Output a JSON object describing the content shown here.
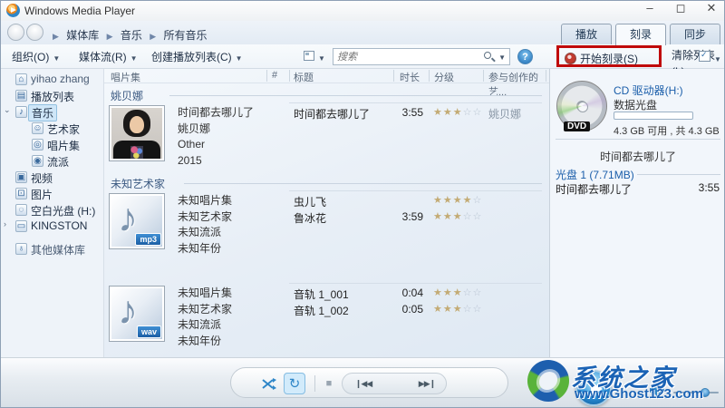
{
  "window": {
    "title": "Windows Media Player",
    "minimize": "–",
    "maximize": "◻",
    "close": "✕"
  },
  "breadcrumb": {
    "items": [
      "媒体库",
      "音乐",
      "所有音乐"
    ]
  },
  "tabs": [
    {
      "label": "播放",
      "active": false
    },
    {
      "label": "刻录",
      "active": true
    },
    {
      "label": "同步",
      "active": false
    }
  ],
  "toolbar": {
    "organize": "组织(O)",
    "stream": "媒体流(R)",
    "create_playlist": "创建播放列表(C)",
    "search_placeholder": "搜索",
    "help": "?"
  },
  "burn_toolbar": {
    "start_burn": "开始刻录(S)",
    "clear_list": "清除列表(L)"
  },
  "sidebar": {
    "items": [
      {
        "label": "yihao zhang",
        "level": 0,
        "icon": "library-icon",
        "chevron": "",
        "selected": false,
        "dim": true,
        "gap": false
      },
      {
        "label": "播放列表",
        "level": 0,
        "icon": "playlist-icon",
        "chevron": "",
        "selected": false,
        "dim": false,
        "gap": false
      },
      {
        "label": "音乐",
        "level": 0,
        "icon": "music-icon",
        "chevron": "v",
        "selected": true,
        "dim": false,
        "gap": false
      },
      {
        "label": "艺术家",
        "level": 1,
        "icon": "artist-icon",
        "chevron": "",
        "selected": false,
        "dim": false,
        "gap": false
      },
      {
        "label": "唱片集",
        "level": 1,
        "icon": "album-icon",
        "chevron": "",
        "selected": false,
        "dim": false,
        "gap": false
      },
      {
        "label": "流派",
        "level": 1,
        "icon": "genre-icon",
        "chevron": "",
        "selected": false,
        "dim": false,
        "gap": false
      },
      {
        "label": "视频",
        "level": 0,
        "icon": "video-icon",
        "chevron": "",
        "selected": false,
        "dim": false,
        "gap": false
      },
      {
        "label": "图片",
        "level": 0,
        "icon": "pictures-icon",
        "chevron": "",
        "selected": false,
        "dim": false,
        "gap": false
      },
      {
        "label": "空白光盘 (H:)",
        "level": 0,
        "icon": "blank-disc-icon",
        "chevron": "",
        "selected": false,
        "dim": false,
        "gap": false
      },
      {
        "label": "KINGSTON",
        "level": 0,
        "icon": "usb-drive-icon",
        "chevron": ">",
        "selected": false,
        "dim": false,
        "gap": false
      },
      {
        "label": "其他媒体库",
        "level": 0,
        "icon": "other-libraries-icon",
        "chevron": "",
        "selected": false,
        "dim": true,
        "gap": true
      }
    ]
  },
  "list": {
    "columns": [
      "唱片集",
      "#",
      "标题",
      "时长",
      "分级",
      "参与创作的艺..."
    ],
    "groups": [
      {
        "header": "姚贝娜",
        "album": {
          "art": "portrait",
          "badge": "",
          "lines": [
            "时间都去哪儿了",
            "姚贝娜",
            "Other",
            "2015"
          ]
        },
        "tracks": [
          {
            "title": "时间都去哪儿了",
            "duration": "3:55",
            "rating": 3,
            "artist": "姚贝娜"
          }
        ]
      },
      {
        "header": "未知艺术家",
        "album": {
          "art": "note",
          "badge": "mp3",
          "lines": [
            "未知唱片集",
            "未知艺术家",
            "未知流派",
            "未知年份"
          ]
        },
        "tracks": [
          {
            "title": "虫儿飞",
            "duration": "",
            "rating": 4,
            "artist": ""
          },
          {
            "title": "鲁冰花",
            "duration": "3:59",
            "rating": 3,
            "artist": ""
          }
        ]
      },
      {
        "header": "",
        "album": {
          "art": "note",
          "badge": "wav",
          "lines": [
            "未知唱片集",
            "未知艺术家",
            "未知流派",
            "未知年份"
          ]
        },
        "tracks": [
          {
            "title": "音轨 1_001",
            "duration": "0:04",
            "rating": 3,
            "artist": ""
          },
          {
            "title": "音轨 1_002",
            "duration": "0:05",
            "rating": 3,
            "artist": ""
          }
        ]
      }
    ]
  },
  "burn_panel": {
    "drive_name": "CD 驱动器(H:)",
    "disc_type": "数据光盘",
    "disc_label": "DVD",
    "capacity": "4.3 GB 可用 , 共 4.3 GB",
    "burn_list_title": "时间都去哪儿了",
    "disc_group": "光盘 1 (7.71MB)",
    "tracks": [
      {
        "title": "时间都去哪儿了",
        "duration": "3:55"
      }
    ]
  },
  "playback": {
    "prev": "❙◀◀",
    "next": "▶▶❙",
    "stop": "■",
    "repeat": "↻"
  },
  "watermark": {
    "title": "系统之家",
    "url": "www.Ghost123.com"
  }
}
